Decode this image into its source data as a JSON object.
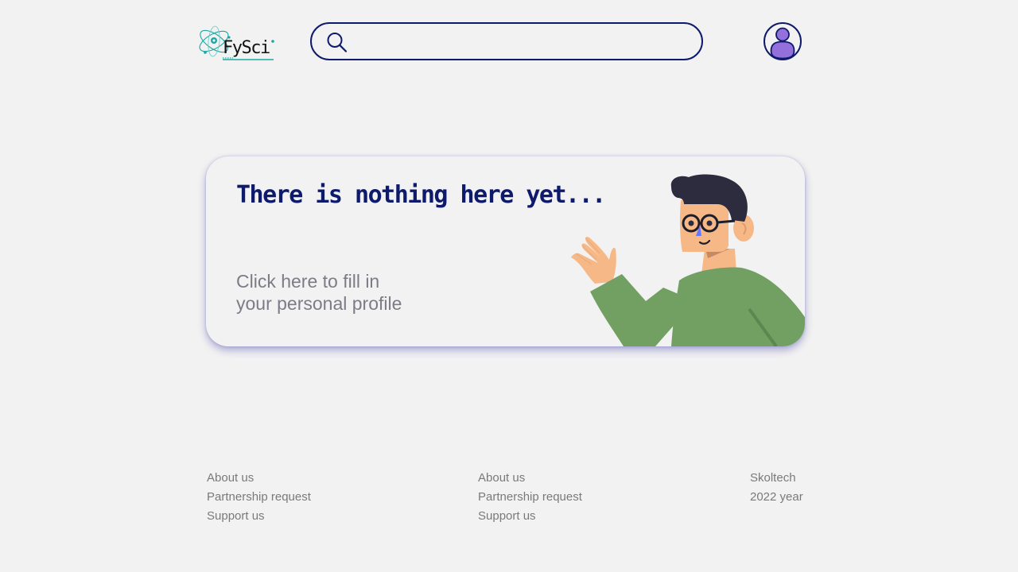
{
  "header": {
    "logo_text": "FySci",
    "logo_icon": "atom-logo-icon",
    "search": {
      "value": "",
      "placeholder": "",
      "icon": "search-icon"
    },
    "profile_icon": "user-avatar-icon"
  },
  "empty_state": {
    "title": "There is nothing here yet...",
    "cta_line1": "Click here to fill in",
    "cta_line2": "your personal profile",
    "illustration": "waving-person-illustration"
  },
  "footer": {
    "columns": [
      {
        "links": [
          "About us",
          "Partnership request",
          "Support us"
        ]
      },
      {
        "links": [
          "About us",
          "Partnership request",
          "Support us"
        ]
      },
      {
        "lines": [
          "Skoltech",
          "2022 year"
        ]
      }
    ]
  },
  "colors": {
    "background": "#f2f2f2",
    "primary_navy": "#0e1a6b",
    "avatar_purple": "#9370db",
    "muted_text": "#7c7c86",
    "sweater_green": "#72a062",
    "logo_teal": "#1aa7a1"
  }
}
